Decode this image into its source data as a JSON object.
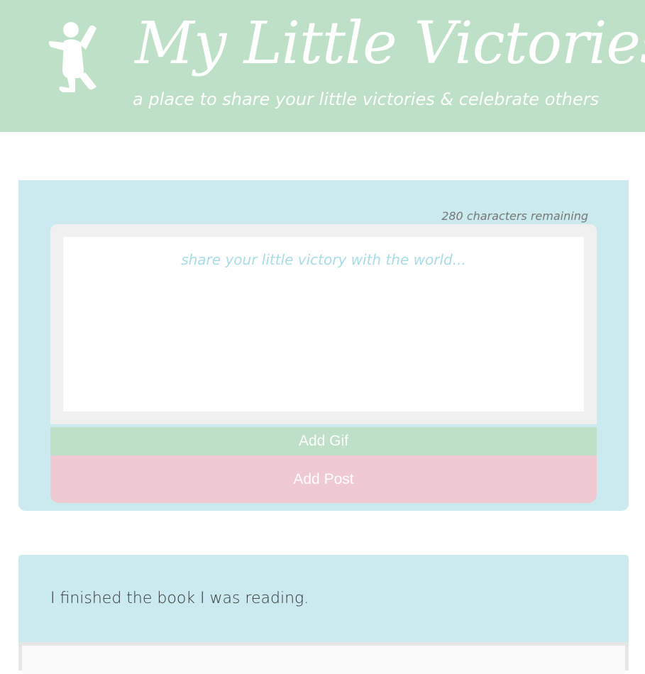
{
  "header": {
    "title": "My Little Victories",
    "tagline": "a place to share your little victories & celebrate others",
    "logo_icon": "jumping-person-icon"
  },
  "composer": {
    "counter": "280 characters remaining",
    "placeholder": "share your little victory with the world...",
    "value": "",
    "add_gif_label": "Add Gif",
    "add_post_label": "Add Post"
  },
  "posts": [
    {
      "text": "I finished the book I was reading."
    }
  ],
  "colors": {
    "mint": "#bde0c6",
    "light_blue": "#cbeaef",
    "pink": "#f0cad2",
    "gray_frame": "#f0f0f0"
  }
}
